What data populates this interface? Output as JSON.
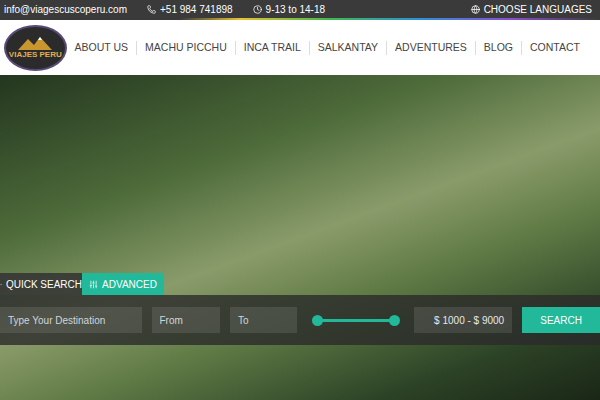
{
  "top_bar": {
    "email": "info@viagescuscoperu.com",
    "phone": "+51 984 741898",
    "hours": "9-13 to 14-18",
    "language": "CHOOSE LANGUAGES"
  },
  "logo": {
    "name": "VIAJES PERU"
  },
  "nav": {
    "items": [
      {
        "label": "ABOUT US",
        "selected": false
      },
      {
        "label": "MACHU PICCHU",
        "selected": false
      },
      {
        "label": "INCA TRAIL",
        "selected": false
      },
      {
        "label": "SALKANTAY",
        "selected": false
      },
      {
        "label": "ADVENTURES",
        "selected": false
      },
      {
        "label": "BLOG",
        "selected": false
      },
      {
        "label": "CONTACT",
        "selected": false
      }
    ]
  },
  "search": {
    "tabs": [
      {
        "label": "QUICK SEARCH",
        "selected": false
      },
      {
        "label": "ADVANCED",
        "selected": true
      }
    ],
    "destination_placeholder": "Type Your Destination",
    "from_placeholder": "From",
    "to_placeholder": "To",
    "price_slider": {
      "level_start": 0,
      "level_end": 1
    },
    "price_reading": "$ 1000 - $ 9000",
    "button": "SEARCH"
  }
}
